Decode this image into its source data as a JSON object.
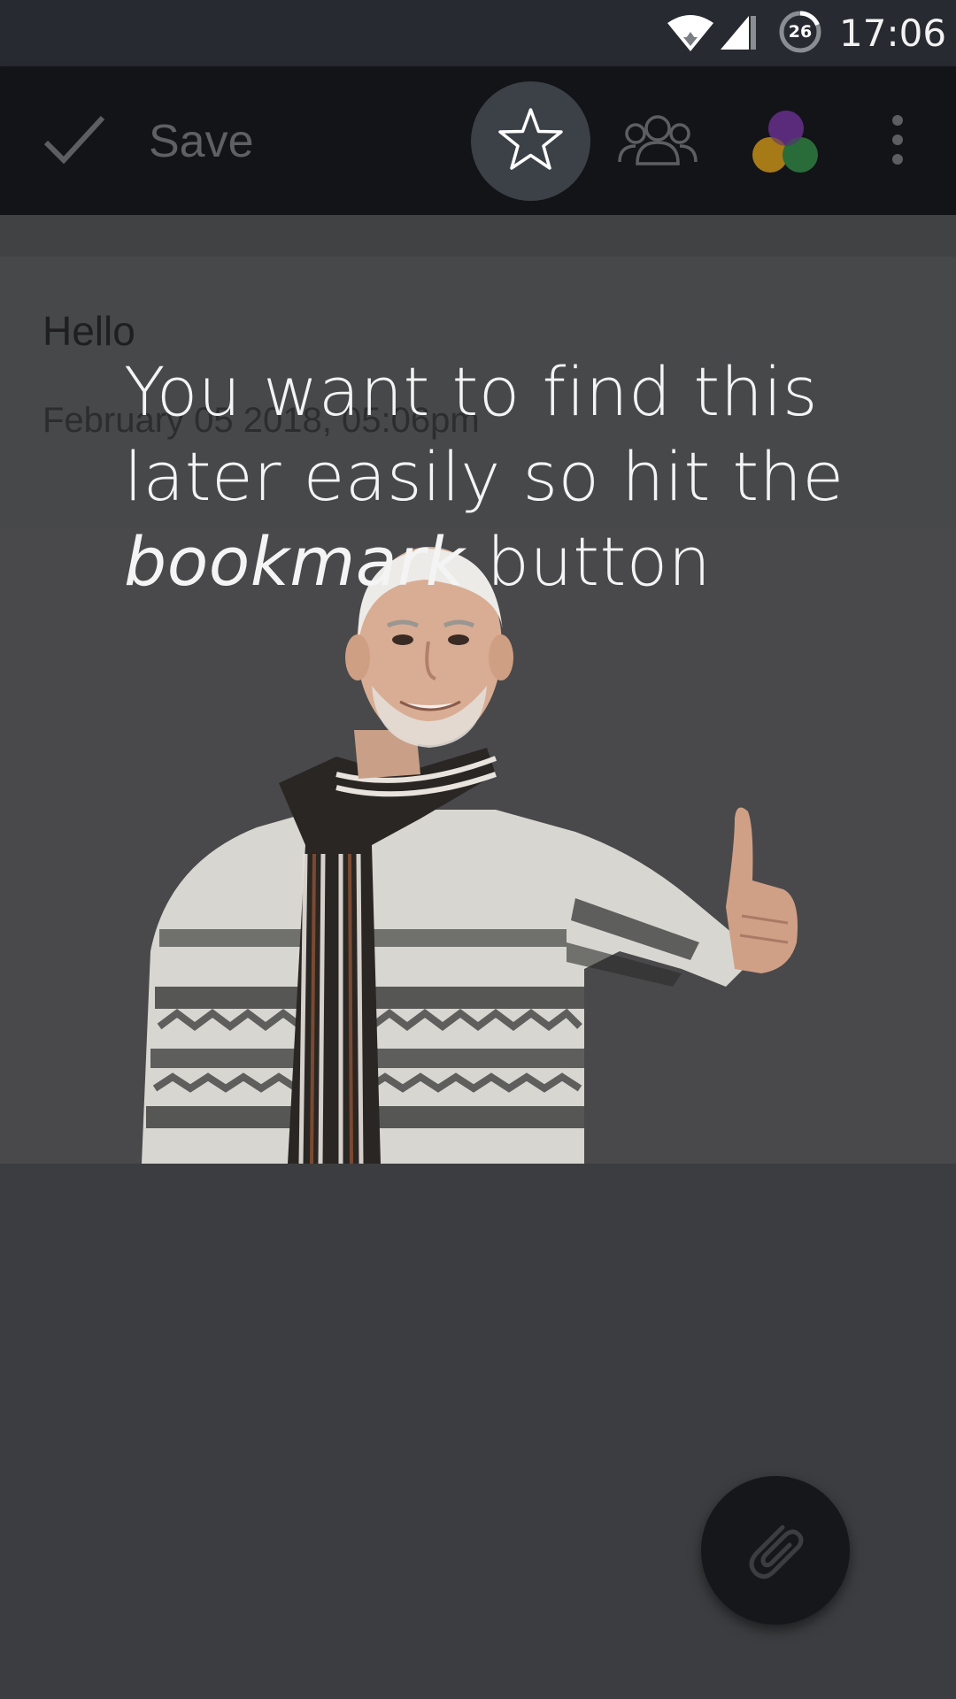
{
  "status_bar": {
    "time": "17:06",
    "battery_level": "26",
    "icons": [
      "wifi-icon",
      "cell-signal-icon",
      "battery-icon"
    ]
  },
  "toolbar": {
    "save_label": "Save",
    "icons": [
      "check-icon",
      "star-icon",
      "people-icon",
      "color-circles-icon",
      "more-vertical-icon"
    ]
  },
  "note": {
    "title": "Hello",
    "date": "February 05 2018, 05:06pm"
  },
  "tutorial": {
    "line_1": "You want to find this",
    "line_2": "later easily so hit the",
    "emphasis": "bookmark",
    "line_3_rest": " button"
  },
  "fab": {
    "icon": "paperclip-icon"
  },
  "colors": {
    "status_bar": "#272a30",
    "toolbar": "#131417",
    "highlight_circle": "#3c4148",
    "overlay_background": "#3c3d40",
    "color_dot_purple": "#5a2b7a",
    "color_dot_orange": "#a67a17",
    "color_dot_green": "#2a6b3a"
  }
}
